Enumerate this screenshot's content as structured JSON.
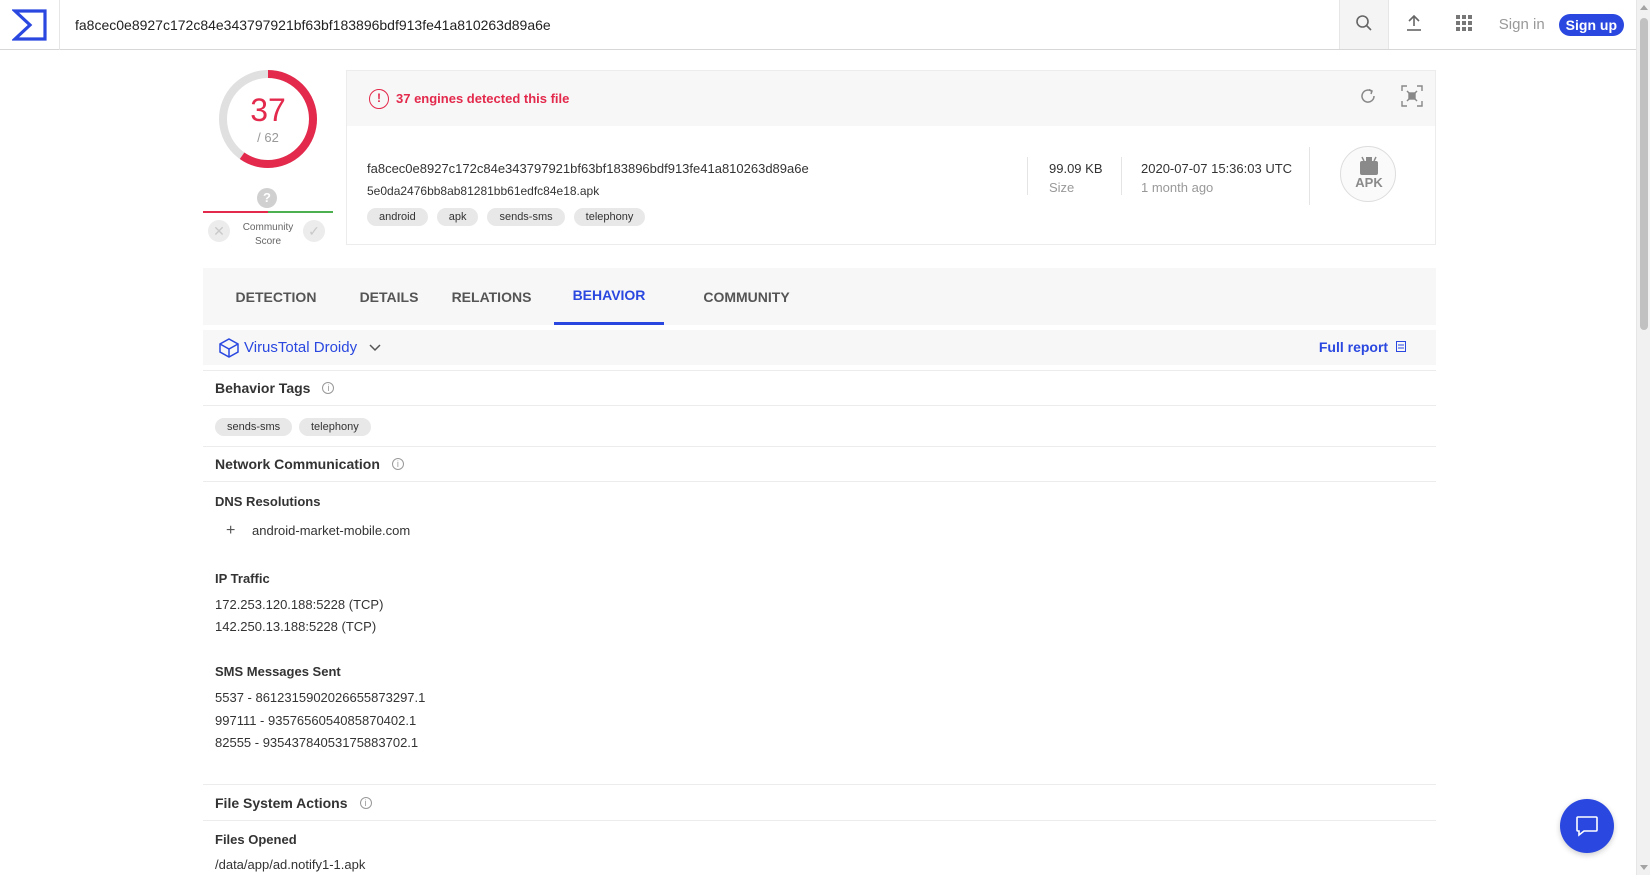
{
  "search": {
    "value": "fa8cec0e8927c172c84e343797921bf63bf183896bdf913fe41a810263d89a6e"
  },
  "header": {
    "sign_in": "Sign in",
    "sign_up": "Sign up"
  },
  "score": {
    "detected": "37",
    "total": "/ 62",
    "community_label_1": "Community",
    "community_label_2": "Score",
    "community_unknown": "?"
  },
  "summary": {
    "alert": "37 engines detected this file",
    "sha256": "fa8cec0e8927c172c84e343797921bf63bf183896bdf913fe41a810263d89a6e",
    "filename": "5e0da2476bb8ab81281bb61edfc84e18.apk",
    "tags": [
      "android",
      "apk",
      "sends-sms",
      "telephony"
    ],
    "size_value": "99.09 KB",
    "size_label": "Size",
    "date_value": "2020-07-07 15:36:03 UTC",
    "date_label": "1 month ago",
    "file_type": "APK"
  },
  "tabs": [
    "DETECTION",
    "DETAILS",
    "RELATIONS",
    "BEHAVIOR",
    "COMMUNITY"
  ],
  "active_tab": "BEHAVIOR",
  "sandbox": {
    "name": "VirusTotal Droidy",
    "full_report": "Full report"
  },
  "behavior": {
    "tags_title": "Behavior Tags",
    "tags": [
      "sends-sms",
      "telephony"
    ],
    "network_title": "Network Communication",
    "dns_title": "DNS Resolutions",
    "dns": [
      "android-market-mobile.com"
    ],
    "ip_title": "IP Traffic",
    "ip": [
      "172.253.120.188:5228 (TCP)",
      "142.250.13.188:5228 (TCP)"
    ],
    "sms_title": "SMS Messages Sent",
    "sms": [
      "5537 - 8612315902026655873297.1",
      "997111 - 9357656054085870402.1",
      "82555 - 93543784053175883702.1"
    ],
    "fs_title": "File System Actions",
    "files_opened_title": "Files Opened",
    "files_opened": [
      "/data/app/ad.notify1-1.apk"
    ]
  },
  "colors": {
    "accent": "#2a48e0",
    "danger": "#e3294c",
    "good": "#4caf50"
  },
  "icons": [
    "virustotal-logo",
    "search-icon",
    "upload-icon",
    "apps-grid-icon",
    "alert-icon",
    "reanalyze-icon",
    "similar-icon",
    "android-icon",
    "droidy-icon",
    "chevron-down-icon",
    "report-icon",
    "info-icon",
    "plus-icon",
    "chat-icon"
  ]
}
